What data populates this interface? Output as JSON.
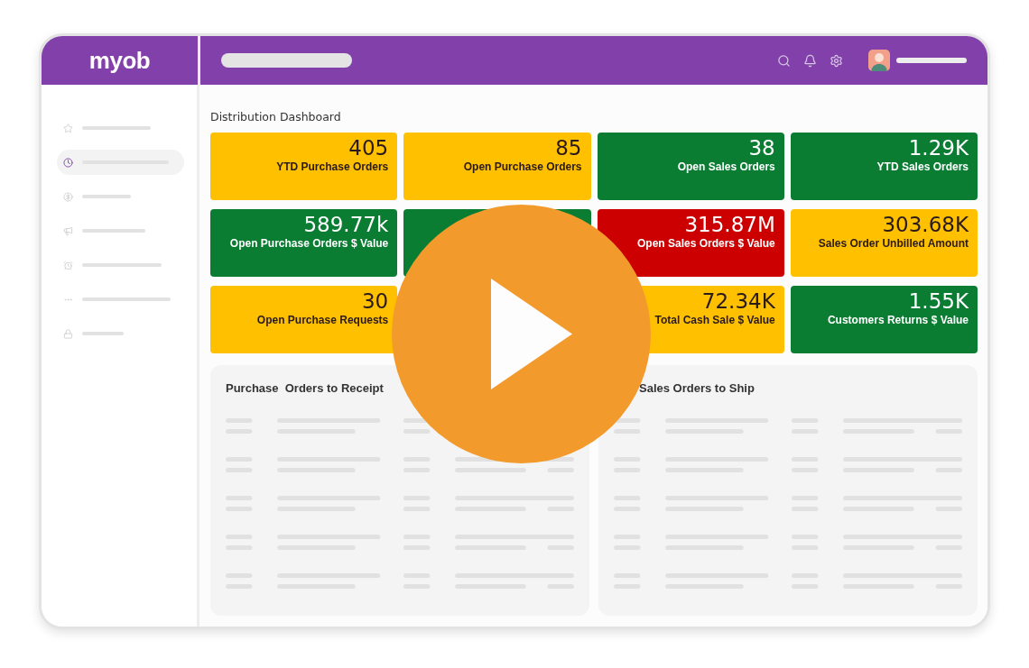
{
  "header": {
    "logo": "myob"
  },
  "sidebar": {
    "items": [
      {
        "selected": false
      },
      {
        "selected": true
      },
      {
        "selected": false
      },
      {
        "selected": false
      },
      {
        "selected": false
      },
      {
        "selected": false
      },
      {
        "selected": false
      }
    ]
  },
  "dashboard": {
    "title": "Distribution Dashboard",
    "tiles": [
      {
        "value": "405",
        "label": "YTD Purchase Orders",
        "color": "#ffc000"
      },
      {
        "value": "85",
        "label": "Open Purchase Orders",
        "color": "#ffc000"
      },
      {
        "value": "38",
        "label": "Open Sales Orders",
        "color": "#0a7d33"
      },
      {
        "value": "1.29K",
        "label": "YTD Sales Orders",
        "color": "#0a7d33"
      },
      {
        "value": "589.77k",
        "label": "Open Purchase Orders $ Value",
        "color": "#0a7d33"
      },
      {
        "kind": "tile",
        "color": "#0a7d33"
      },
      {
        "value": "315.87M",
        "label": "Open Sales Orders $ Value",
        "color": "#cc0000"
      },
      {
        "value": "303.68K",
        "label": "Sales Order Unbilled Amount",
        "color": "#ffc000"
      },
      {
        "value": "30",
        "label": "Open Purchase Requests",
        "color": "#ffc000"
      },
      {
        "kind": "covered"
      },
      {
        "value": "72.34K",
        "label": "Total Cash Sale $ Value",
        "color": "#ffc000"
      },
      {
        "value": "1.55K",
        "label": "Customers Returns $ Value",
        "color": "#0a7d33"
      }
    ]
  },
  "panels": [
    {
      "title": "Purchase  Orders to Receipt"
    },
    {
      "title": "Sales Orders to Ship"
    }
  ]
}
